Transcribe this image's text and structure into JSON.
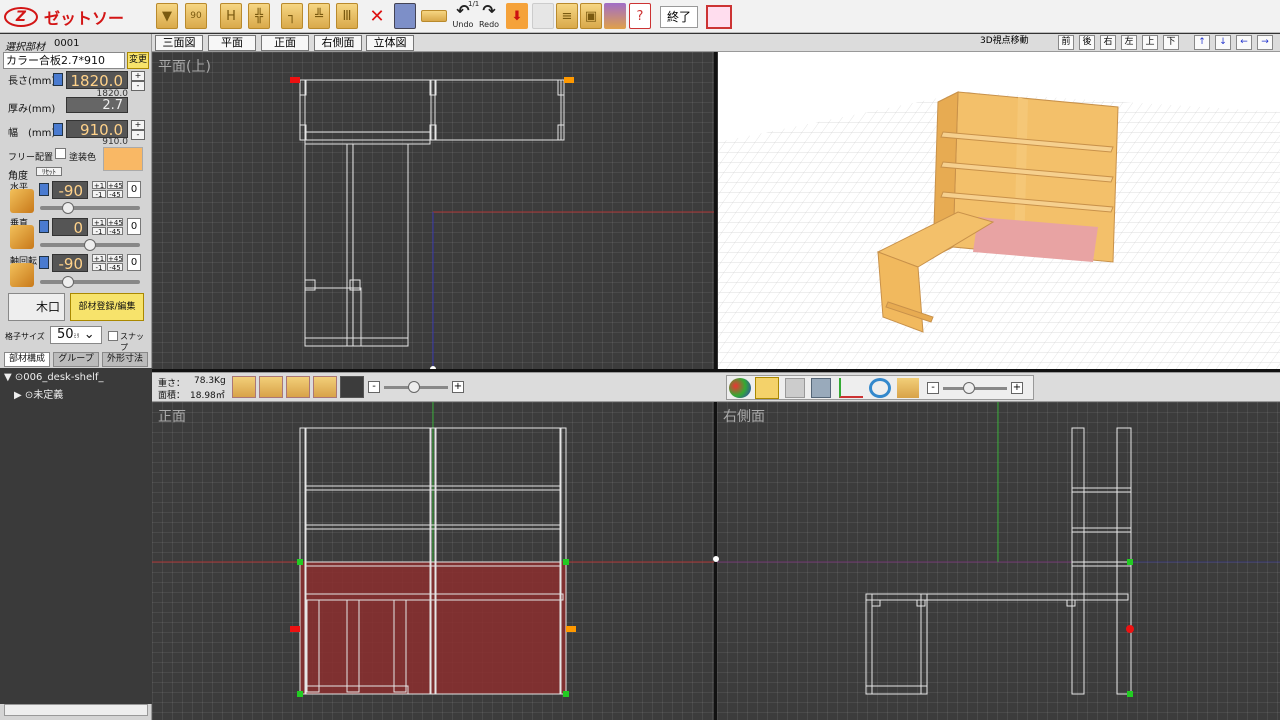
{
  "app": {
    "logo_text": "ゼットソー",
    "logo_mark": "Z"
  },
  "toolbar": {
    "undo_label": "Undo",
    "redo_label": "Redo",
    "undo_sup": "1/1",
    "end_label": "終了",
    "icon_90": "90"
  },
  "part": {
    "selected_label": "選択部材",
    "selected_id": "0001",
    "material": "カラー合板2.7*910",
    "change_label": "変更",
    "length_label": "長さ(mm)",
    "length_value": "1820.0",
    "length_sub": "1820.0",
    "thickness_label": "厚み(mm)",
    "thickness_value": "2.7",
    "width_label": "幅　(mm)",
    "width_value": "910.0",
    "width_sub": "910.0",
    "free_label": "フリー配置",
    "paint_label": "塗装色",
    "paint_color": "#f9b865",
    "angle_label": "角度",
    "reset_label": "ﾘｾｯﾄ",
    "horizontal_label": "水平",
    "horizontal_value": "-90",
    "vertical_label": "垂直",
    "vertical_value": "0",
    "axis_label": "軸回転",
    "axis_value": "-90",
    "step_p1": "+1",
    "step_p45": "+45",
    "step_m1": "-1",
    "step_m45": "-45",
    "zero": "0",
    "kiguchi_label": "木口",
    "register_label": "部材登録/編集",
    "grid_label": "格子サイズ",
    "grid_value": "50",
    "grid_unit": "ﾐﾘ",
    "snap_label": "スナップ"
  },
  "tree": {
    "tabs": [
      "部材構成",
      "グループ",
      "外形寸法"
    ],
    "root": "006_desk-shelf_",
    "child": "未定義"
  },
  "viewtabs": [
    "三面図",
    "平面",
    "正面",
    "右側面",
    "立体図"
  ],
  "view3d_controls": {
    "label": "3D視点移動",
    "buttons": [
      "前",
      "後",
      "右",
      "左",
      "上",
      "下"
    ],
    "arrows": [
      "↑",
      "↓",
      "←",
      "→"
    ]
  },
  "views": {
    "top": "平面(上)",
    "front": "正面",
    "right": "右側面"
  },
  "stats": {
    "weight_label": "重さ：",
    "weight_value": "78.3Kg",
    "area_label": "面積：",
    "area_value": "18.98㎡"
  },
  "colors": {
    "accent": "#f9b865",
    "highlight": "#8b2e2e",
    "line": "#e6e6e6"
  }
}
